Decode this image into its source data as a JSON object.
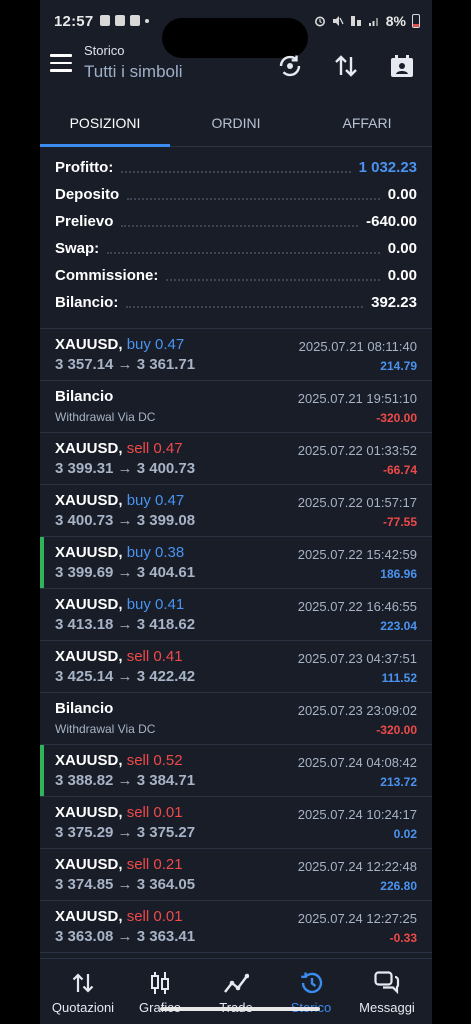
{
  "status_bar": {
    "time": "12:57",
    "battery": "8%"
  },
  "header": {
    "subtitle": "Storico",
    "title": "Tutti i simboli"
  },
  "tabs": [
    {
      "label": "POSIZIONI",
      "active": true
    },
    {
      "label": "ORDINI",
      "active": false
    },
    {
      "label": "AFFARI",
      "active": false
    }
  ],
  "summary": [
    {
      "label": "Profitto:",
      "value": "1 032.23",
      "highlight": true
    },
    {
      "label": "Deposito",
      "value": "0.00"
    },
    {
      "label": "Prelievo",
      "value": "-640.00"
    },
    {
      "label": "Swap:",
      "value": "0.00"
    },
    {
      "label": "Commissione:",
      "value": "0.00"
    },
    {
      "label": "Bilancio:",
      "value": "392.23"
    }
  ],
  "trades": [
    {
      "kind": "trade",
      "symbol": "XAUUSD,",
      "side": "buy",
      "volume": "0.47",
      "prices": "3 357.14 → 3 361.71",
      "date": "2025.07.21 08:11:40",
      "pl": "214.79",
      "marked": false
    },
    {
      "kind": "balance",
      "symbol": "Bilancio",
      "note": "Withdrawal Via DC",
      "date": "2025.07.21 19:51:10",
      "pl": "-320.00",
      "marked": false
    },
    {
      "kind": "trade",
      "symbol": "XAUUSD,",
      "side": "sell",
      "volume": "0.47",
      "prices": "3 399.31 → 3 400.73",
      "date": "2025.07.22 01:33:52",
      "pl": "-66.74",
      "marked": false
    },
    {
      "kind": "trade",
      "symbol": "XAUUSD,",
      "side": "buy",
      "volume": "0.47",
      "prices": "3 400.73 → 3 399.08",
      "date": "2025.07.22 01:57:17",
      "pl": "-77.55",
      "marked": false
    },
    {
      "kind": "trade",
      "symbol": "XAUUSD,",
      "side": "buy",
      "volume": "0.38",
      "prices": "3 399.69 → 3 404.61",
      "date": "2025.07.22 15:42:59",
      "pl": "186.96",
      "marked": true
    },
    {
      "kind": "trade",
      "symbol": "XAUUSD,",
      "side": "buy",
      "volume": "0.41",
      "prices": "3 413.18 → 3 418.62",
      "date": "2025.07.22 16:46:55",
      "pl": "223.04",
      "marked": false
    },
    {
      "kind": "trade",
      "symbol": "XAUUSD,",
      "side": "sell",
      "volume": "0.41",
      "prices": "3 425.14 → 3 422.42",
      "date": "2025.07.23 04:37:51",
      "pl": "111.52",
      "marked": false
    },
    {
      "kind": "balance",
      "symbol": "Bilancio",
      "note": "Withdrawal Via DC",
      "date": "2025.07.23 23:09:02",
      "pl": "-320.00",
      "marked": false
    },
    {
      "kind": "trade",
      "symbol": "XAUUSD,",
      "side": "sell",
      "volume": "0.52",
      "prices": "3 388.82 → 3 384.71",
      "date": "2025.07.24 04:08:42",
      "pl": "213.72",
      "marked": true
    },
    {
      "kind": "trade",
      "symbol": "XAUUSD,",
      "side": "sell",
      "volume": "0.01",
      "prices": "3 375.29 → 3 375.27",
      "date": "2025.07.24 10:24:17",
      "pl": "0.02",
      "marked": false
    },
    {
      "kind": "trade",
      "symbol": "XAUUSD,",
      "side": "sell",
      "volume": "0.21",
      "prices": "3 374.85 → 3 364.05",
      "date": "2025.07.24 12:22:48",
      "pl": "226.80",
      "marked": false
    },
    {
      "kind": "trade",
      "symbol": "XAUUSD,",
      "side": "sell",
      "volume": "0.01",
      "prices": "3 363.08 → 3 363.41",
      "date": "2025.07.24 12:27:25",
      "pl": "-0.33",
      "marked": false
    }
  ],
  "bottom_nav": [
    {
      "label": "Quotazioni",
      "icon": "quotes-arrows-icon",
      "active": false
    },
    {
      "label": "Grafico",
      "icon": "candlestick-chart-icon",
      "active": false
    },
    {
      "label": "Trade",
      "icon": "trade-line-icon",
      "active": false
    },
    {
      "label": "Storico",
      "icon": "history-clock-icon",
      "active": true
    },
    {
      "label": "Messaggi",
      "icon": "messages-icon",
      "active": false
    }
  ],
  "colors": {
    "background": "#181d27",
    "accent": "#3b8cf0",
    "buy": "#4a93f0",
    "sell": "#ef4a4a",
    "marker": "#31b35a"
  }
}
